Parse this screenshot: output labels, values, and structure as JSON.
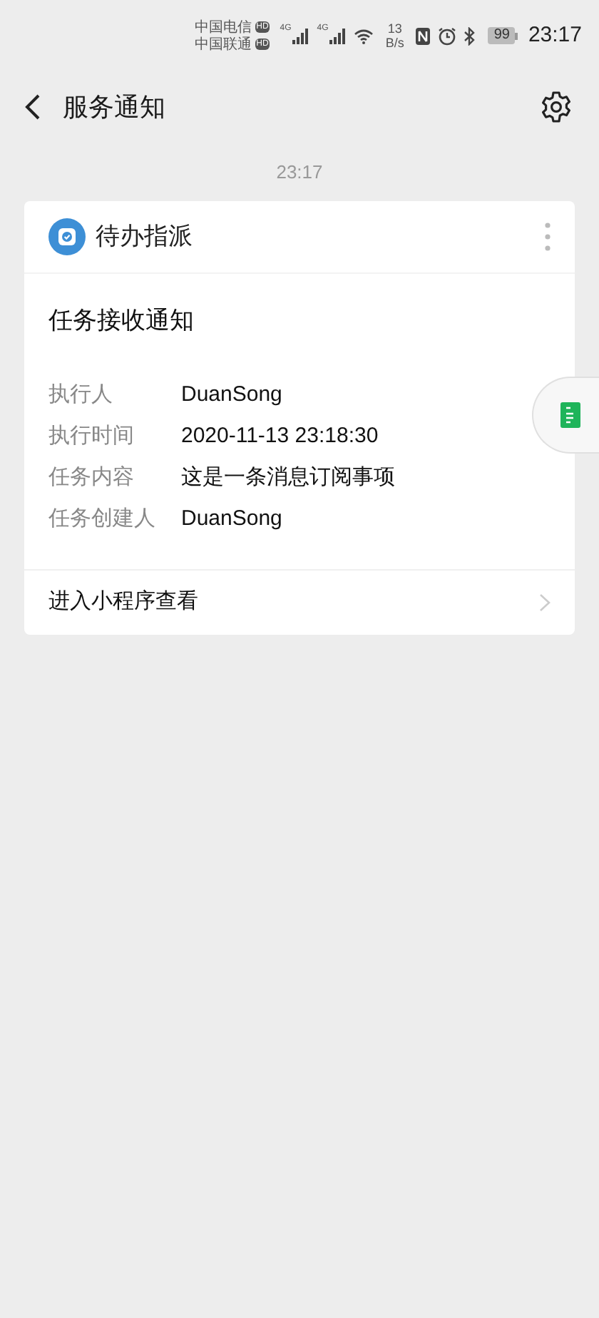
{
  "status_bar": {
    "carriers": [
      {
        "name": "中国电信",
        "badge": "HD"
      },
      {
        "name": "中国联通",
        "badge": "HD"
      }
    ],
    "network": [
      "4G",
      "4G"
    ],
    "speed": "13",
    "speed_unit": "B/s",
    "battery": "99",
    "time": "23:17"
  },
  "header": {
    "title": "服务通知"
  },
  "timestamp": "23:17",
  "card": {
    "app_name": "待办指派",
    "title": "任务接收通知",
    "fields": [
      {
        "label": "执行人",
        "value": "DuanSong"
      },
      {
        "label": "执行时间",
        "value": "2020-11-13 23:18:30"
      },
      {
        "label": "任务内容",
        "value": "这是一条消息订阅事项"
      },
      {
        "label": "任务创建人",
        "value": "DuanSong"
      }
    ],
    "footer": "进入小程序查看"
  }
}
